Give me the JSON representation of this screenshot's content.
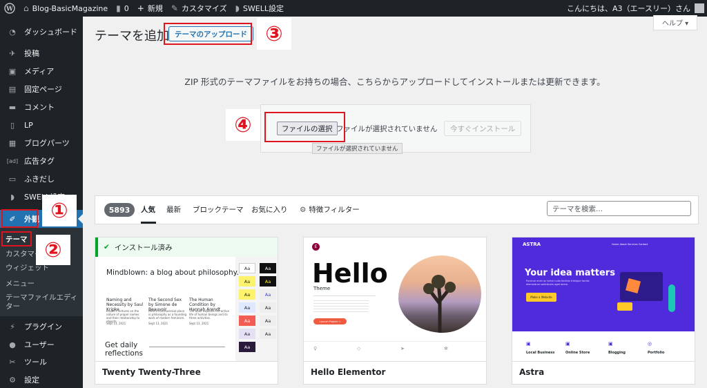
{
  "admin_bar": {
    "wp_logo": "wordpress-icon",
    "site_name": "Blog-BasicMagazine",
    "comments_count": "0",
    "new_label": "新規",
    "customize_label": "カスタマイズ",
    "swell_label": "SWELL設定",
    "greeting": "こんにちは、A3（エースリー）さん"
  },
  "sidebar": {
    "items": [
      {
        "label": "ダッシュボード",
        "icon": "dashboard-icon"
      },
      {
        "label": "投稿",
        "icon": "pin-icon"
      },
      {
        "label": "メディア",
        "icon": "media-icon"
      },
      {
        "label": "固定ページ",
        "icon": "page-icon"
      },
      {
        "label": "コメント",
        "icon": "comment-icon"
      },
      {
        "label": "LP",
        "icon": "lp-icon"
      },
      {
        "label": "ブログパーツ",
        "icon": "blog-parts-icon"
      },
      {
        "label": "広告タグ",
        "icon": "ad-icon",
        "glyph": "[ad]"
      },
      {
        "label": "ふきだし",
        "icon": "balloon-icon"
      },
      {
        "label": "SWELL設定",
        "icon": "swell-icon"
      },
      {
        "label": "外観",
        "icon": "appearance-icon"
      },
      {
        "label": "プラグイン",
        "icon": "plugin-icon"
      },
      {
        "label": "ユーザー",
        "icon": "user-icon"
      },
      {
        "label": "ツール",
        "icon": "tool-icon"
      },
      {
        "label": "設定",
        "icon": "settings-icon"
      }
    ],
    "submenu": [
      "テーマ",
      "カスタマイズ",
      "ウィジェット",
      "メニュー",
      "テーマファイルエディター"
    ],
    "submenu_editor_line1": "テーマファイルエディ",
    "submenu_editor_line2": "ター"
  },
  "markers": [
    "①",
    "②",
    "③",
    "④"
  ],
  "page": {
    "title": "テーマを追加",
    "upload_button": "テーマのアップロード",
    "help": "ヘルプ ▾",
    "description": "ZIP 形式のテーマファイルをお持ちの場合、こちらからアップロードしてインストールまたは更新できます。",
    "choose_file": "ファイルの選択",
    "no_file": "ファイルが選択されていません",
    "install_now": "今すぐインストール",
    "tooltip": "ファイルが選択されていません"
  },
  "filter": {
    "count": "5893",
    "tabs": [
      "人気",
      "最新",
      "ブロックテーマ",
      "お気に入り"
    ],
    "feature_filter": "特徴フィルター",
    "search_placeholder": "テーマを検索..."
  },
  "themes": [
    {
      "name": "Twenty Twenty-Three",
      "installed_label": "インストール済み",
      "preview": {
        "headline": "Mindblown: a blog about philosophy.",
        "posts": [
          {
            "title": "Naming and Necessity by Saul Kripke",
            "text": "Kripke's lectures on the nature of proper names and their relationship to objects.",
            "date": "Sept 13, 2021"
          },
          {
            "title": "The Second Sex by Simone de Beauvoir",
            "text": "Held a controversial place in philosophy as a founding work of modern feminism.",
            "date": "Sept 13, 2021"
          },
          {
            "title": "The Human Condition by Hannah Arendt",
            "text": "The book explores the active life of human beings and its three activities.",
            "date": "Sept 13, 2021"
          }
        ],
        "footer_text_line1": "Get daily",
        "footer_text_line2": "reflections",
        "swatch_label": "Aa"
      }
    },
    {
      "name": "Hello Elementor",
      "preview": {
        "big": "Hello",
        "sub": "Theme",
        "cta": "Launch Project →",
        "logo_letter": "E"
      }
    },
    {
      "name": "Astra",
      "preview": {
        "logo": "ASTRA",
        "nav": "Home   About   Services   Contact",
        "headline": "Your idea matters",
        "text": "Pulvinar enim ac tortor nulla facilisis tristique facilisi elementum sollicitudin eget lorem.",
        "cta": "Make a Website",
        "features": [
          "Local Business",
          "Online Store",
          "Blogging",
          "Portfolio"
        ]
      }
    }
  ]
}
